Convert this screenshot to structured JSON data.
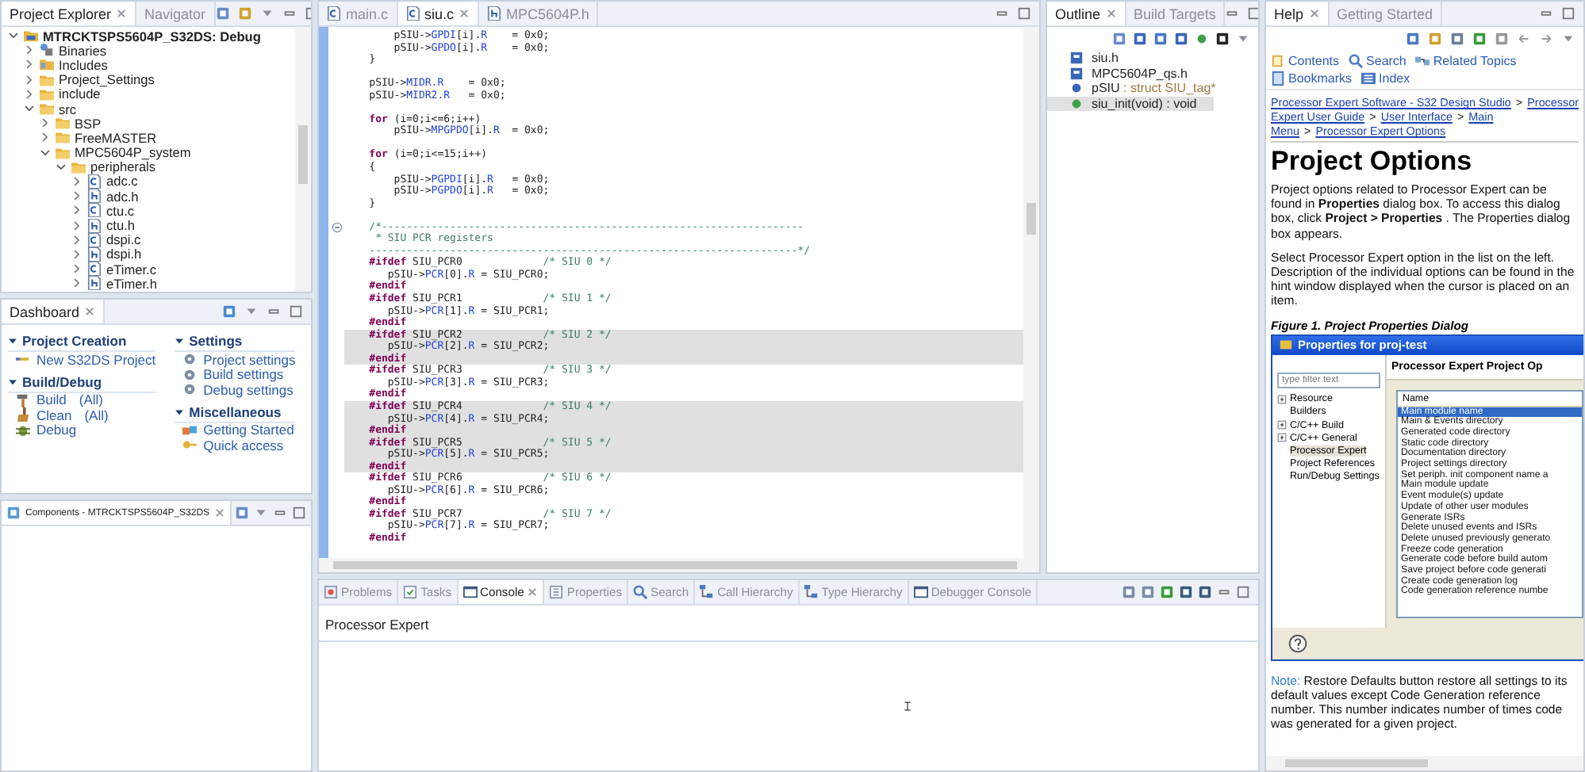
{
  "project_explorer": {
    "tabs": [
      {
        "label": "Project Explorer",
        "selected": true
      },
      {
        "label": "Navigator",
        "selected": false
      }
    ],
    "tree": [
      {
        "label": "MTRCKTSPS5604P_S32DS: Debug",
        "kind": "project",
        "expanded": true,
        "children": [
          {
            "label": "Binaries",
            "kind": "binaries",
            "expanded": false
          },
          {
            "label": "Includes",
            "kind": "includes",
            "expanded": false
          },
          {
            "label": "Project_Settings",
            "kind": "folder",
            "expanded": false
          },
          {
            "label": "include",
            "kind": "folder",
            "expanded": false
          },
          {
            "label": "src",
            "kind": "folder",
            "expanded": true,
            "children": [
              {
                "label": "BSP",
                "kind": "folder",
                "expanded": false
              },
              {
                "label": "FreeMASTER",
                "kind": "folder",
                "expanded": false
              },
              {
                "label": "MPC5604P_system",
                "kind": "folder",
                "expanded": true,
                "children": [
                  {
                    "label": "peripherals",
                    "kind": "folder",
                    "expanded": true,
                    "children": [
                      {
                        "label": "adc.c",
                        "kind": "c",
                        "expanded": false
                      },
                      {
                        "label": "adc.h",
                        "kind": "h",
                        "expanded": false
                      },
                      {
                        "label": "ctu.c",
                        "kind": "c",
                        "expanded": false
                      },
                      {
                        "label": "ctu.h",
                        "kind": "h",
                        "expanded": false
                      },
                      {
                        "label": "dspi.c",
                        "kind": "c",
                        "expanded": false
                      },
                      {
                        "label": "dspi.h",
                        "kind": "h",
                        "expanded": false
                      },
                      {
                        "label": "eTimer.c",
                        "kind": "c",
                        "expanded": false
                      },
                      {
                        "label": "eTimer.h",
                        "kind": "h",
                        "expanded": false
                      }
                    ]
                  }
                ]
              }
            ]
          }
        ]
      }
    ]
  },
  "dashboard": {
    "title": "Dashboard",
    "columns": [
      [
        {
          "title": "Project Creation",
          "expanded": true,
          "links": [
            {
              "label": "New S32DS Project",
              "kind": "new"
            }
          ]
        },
        {
          "title": "Build/Debug",
          "expanded": true,
          "links": [
            {
              "label": "Build",
              "extra": "(All)",
              "kind": "build"
            },
            {
              "label": "Clean",
              "extra": "(All)",
              "kind": "clean"
            },
            {
              "label": "Debug",
              "kind": "debug"
            }
          ]
        }
      ],
      [
        {
          "title": "Settings",
          "expanded": true,
          "links": [
            {
              "label": "Project settings",
              "kind": "settings"
            },
            {
              "label": "Build settings",
              "kind": "settings"
            },
            {
              "label": "Debug settings",
              "kind": "settings"
            }
          ]
        },
        {
          "title": "Miscellaneous",
          "expanded": true,
          "links": [
            {
              "label": "Getting Started",
              "kind": "started"
            },
            {
              "label": "Quick access",
              "kind": "key"
            }
          ]
        }
      ]
    ]
  },
  "components": {
    "title": "Components - MTRCKTSPS5604P_S32DS"
  },
  "editor": {
    "tabs": [
      {
        "label": "main.c",
        "kind": "c",
        "selected": false
      },
      {
        "label": "siu.c",
        "kind": "c",
        "selected": true
      },
      {
        "label": "MPC5604P.h",
        "kind": "h",
        "selected": false
      }
    ],
    "lines": [
      {
        "kind": "code",
        "shaded": false,
        "tokens": [
          {
            "kind": "plain",
            "text": "        pSIU->"
          },
          {
            "kind": "field",
            "text": "GPDI"
          },
          {
            "kind": "plain",
            "text": "[i]."
          },
          {
            "kind": "field",
            "text": "R"
          },
          {
            "kind": "plain",
            "text": "    = 0x0;"
          }
        ]
      },
      {
        "kind": "code",
        "shaded": false,
        "tokens": [
          {
            "kind": "plain",
            "text": "        pSIU->"
          },
          {
            "kind": "field",
            "text": "GPDO"
          },
          {
            "kind": "plain",
            "text": "[i]."
          },
          {
            "kind": "field",
            "text": "R"
          },
          {
            "kind": "plain",
            "text": "    = 0x0;"
          }
        ]
      },
      {
        "kind": "code",
        "shaded": false,
        "tokens": [
          {
            "kind": "plain",
            "text": "    }"
          }
        ]
      },
      {
        "kind": "blank",
        "shaded": false
      },
      {
        "kind": "code",
        "shaded": false,
        "tokens": [
          {
            "kind": "plain",
            "text": "    pSIU->"
          },
          {
            "kind": "field",
            "text": "MIDR.R"
          },
          {
            "kind": "plain",
            "text": "    = 0x0;"
          }
        ]
      },
      {
        "kind": "code",
        "shaded": false,
        "tokens": [
          {
            "kind": "plain",
            "text": "    pSIU->"
          },
          {
            "kind": "field",
            "text": "MIDR2.R"
          },
          {
            "kind": "plain",
            "text": "   = 0x0;"
          }
        ]
      },
      {
        "kind": "blank",
        "shaded": false
      },
      {
        "kind": "code",
        "shaded": false,
        "tokens": [
          {
            "kind": "keyword",
            "text": "    for"
          },
          {
            "kind": "plain",
            "text": " (i=0;i<=6;i++)"
          }
        ]
      },
      {
        "kind": "code",
        "shaded": false,
        "tokens": [
          {
            "kind": "plain",
            "text": "        pSIU->"
          },
          {
            "kind": "field",
            "text": "MPGPDO"
          },
          {
            "kind": "plain",
            "text": "[i]."
          },
          {
            "kind": "field",
            "text": "R"
          },
          {
            "kind": "plain",
            "text": "  = 0x0;"
          }
        ]
      },
      {
        "kind": "blank",
        "shaded": false
      },
      {
        "kind": "code",
        "shaded": false,
        "tokens": [
          {
            "kind": "keyword",
            "text": "    for"
          },
          {
            "kind": "plain",
            "text": " (i=0;i<=15;i++)"
          }
        ]
      },
      {
        "kind": "code",
        "shaded": false,
        "tokens": [
          {
            "kind": "plain",
            "text": "    {"
          }
        ]
      },
      {
        "kind": "code",
        "shaded": false,
        "tokens": [
          {
            "kind": "plain",
            "text": "        pSIU->"
          },
          {
            "kind": "field",
            "text": "PGPDI"
          },
          {
            "kind": "plain",
            "text": "[i]."
          },
          {
            "kind": "field",
            "text": "R"
          },
          {
            "kind": "plain",
            "text": "   = 0x0;"
          }
        ]
      },
      {
        "kind": "code",
        "shaded": false,
        "tokens": [
          {
            "kind": "plain",
            "text": "        pSIU->"
          },
          {
            "kind": "field",
            "text": "PGPDO"
          },
          {
            "kind": "plain",
            "text": "[i]."
          },
          {
            "kind": "field",
            "text": "R"
          },
          {
            "kind": "plain",
            "text": "   = 0x0;"
          }
        ]
      },
      {
        "kind": "code",
        "shaded": false,
        "tokens": [
          {
            "kind": "plain",
            "text": "    }"
          }
        ]
      },
      {
        "kind": "blank",
        "shaded": false
      },
      {
        "kind": "fold",
        "shaded": false,
        "tokens": [
          {
            "kind": "comment",
            "text": "    /*--------------------------------------------------------------------"
          }
        ]
      },
      {
        "kind": "code",
        "shaded": false,
        "tokens": [
          {
            "kind": "comment",
            "text": "     * SIU PCR registers"
          }
        ]
      },
      {
        "kind": "code",
        "shaded": false,
        "tokens": [
          {
            "kind": "comment",
            "text": "    ---------------------------------------------------------------------*/"
          }
        ]
      },
      {
        "kind": "code",
        "shaded": false,
        "tokens": [
          {
            "kind": "keyword",
            "text": "    #ifdef"
          },
          {
            "kind": "plain",
            "text": " SIU_PCR0"
          },
          {
            "kind": "comment",
            "text": "             /* SIU 0 */"
          }
        ]
      },
      {
        "kind": "code",
        "shaded": false,
        "tokens": [
          {
            "kind": "plain",
            "text": "       pSIU->"
          },
          {
            "kind": "field",
            "text": "PCR"
          },
          {
            "kind": "plain",
            "text": "[0]."
          },
          {
            "kind": "field",
            "text": "R"
          },
          {
            "kind": "plain",
            "text": " = SIU_PCR0;"
          }
        ]
      },
      {
        "kind": "code",
        "shaded": false,
        "tokens": [
          {
            "kind": "keyword",
            "text": "    #endif"
          }
        ]
      },
      {
        "kind": "code",
        "shaded": false,
        "tokens": [
          {
            "kind": "keyword",
            "text": "    #ifdef"
          },
          {
            "kind": "plain",
            "text": " SIU_PCR1"
          },
          {
            "kind": "comment",
            "text": "             /* SIU 1 */"
          }
        ]
      },
      {
        "kind": "code",
        "shaded": false,
        "tokens": [
          {
            "kind": "plain",
            "text": "       pSIU->"
          },
          {
            "kind": "field",
            "text": "PCR"
          },
          {
            "kind": "plain",
            "text": "[1]."
          },
          {
            "kind": "field",
            "text": "R"
          },
          {
            "kind": "plain",
            "text": " = SIU_PCR1;"
          }
        ]
      },
      {
        "kind": "code",
        "shaded": false,
        "tokens": [
          {
            "kind": "keyword",
            "text": "    #endif"
          }
        ]
      },
      {
        "kind": "code",
        "shaded": true,
        "tokens": [
          {
            "kind": "keyword",
            "text": "    #ifdef"
          },
          {
            "kind": "plain",
            "text": " SIU_PCR2"
          },
          {
            "kind": "comment",
            "text": "             /* SIU 2 */"
          }
        ]
      },
      {
        "kind": "code",
        "shaded": true,
        "tokens": [
          {
            "kind": "plain",
            "text": "       pSIU->"
          },
          {
            "kind": "field",
            "text": "PCR"
          },
          {
            "kind": "plain",
            "text": "[2]."
          },
          {
            "kind": "field",
            "text": "R"
          },
          {
            "kind": "plain",
            "text": " = SIU_PCR2;"
          }
        ]
      },
      {
        "kind": "code",
        "shaded": true,
        "tokens": [
          {
            "kind": "keyword",
            "text": "    #endif"
          }
        ]
      },
      {
        "kind": "code",
        "shaded": false,
        "tokens": [
          {
            "kind": "keyword",
            "text": "    #ifdef"
          },
          {
            "kind": "plain",
            "text": " SIU_PCR3"
          },
          {
            "kind": "comment",
            "text": "             /* SIU 3 */"
          }
        ]
      },
      {
        "kind": "code",
        "shaded": false,
        "tokens": [
          {
            "kind": "plain",
            "text": "       pSIU->"
          },
          {
            "kind": "field",
            "text": "PCR"
          },
          {
            "kind": "plain",
            "text": "[3]."
          },
          {
            "kind": "field",
            "text": "R"
          },
          {
            "kind": "plain",
            "text": " = SIU_PCR3;"
          }
        ]
      },
      {
        "kind": "code",
        "shaded": false,
        "tokens": [
          {
            "kind": "keyword",
            "text": "    #endif"
          }
        ]
      },
      {
        "kind": "code",
        "shaded": true,
        "tokens": [
          {
            "kind": "keyword",
            "text": "    #ifdef"
          },
          {
            "kind": "plain",
            "text": " SIU_PCR4"
          },
          {
            "kind": "comment",
            "text": "             /* SIU 4 */"
          }
        ]
      },
      {
        "kind": "code",
        "shaded": true,
        "tokens": [
          {
            "kind": "plain",
            "text": "       pSIU->"
          },
          {
            "kind": "field",
            "text": "PCR"
          },
          {
            "kind": "plain",
            "text": "[4]."
          },
          {
            "kind": "field",
            "text": "R"
          },
          {
            "kind": "plain",
            "text": " = SIU_PCR4;"
          }
        ]
      },
      {
        "kind": "code",
        "shaded": true,
        "tokens": [
          {
            "kind": "keyword",
            "text": "    #endif"
          }
        ]
      },
      {
        "kind": "code",
        "shaded": true,
        "tokens": [
          {
            "kind": "keyword",
            "text": "    #ifdef"
          },
          {
            "kind": "plain",
            "text": " SIU_PCR5"
          },
          {
            "kind": "comment",
            "text": "             /* SIU 5 */"
          }
        ]
      },
      {
        "kind": "code",
        "shaded": true,
        "tokens": [
          {
            "kind": "plain",
            "text": "       pSIU->"
          },
          {
            "kind": "field",
            "text": "PCR"
          },
          {
            "kind": "plain",
            "text": "[5]."
          },
          {
            "kind": "field",
            "text": "R"
          },
          {
            "kind": "plain",
            "text": " = SIU_PCR5;"
          }
        ]
      },
      {
        "kind": "code",
        "shaded": true,
        "tokens": [
          {
            "kind": "keyword",
            "text": "    #endif"
          }
        ]
      },
      {
        "kind": "code",
        "shaded": false,
        "tokens": [
          {
            "kind": "keyword",
            "text": "    #ifdef"
          },
          {
            "kind": "plain",
            "text": " SIU_PCR6"
          },
          {
            "kind": "comment",
            "text": "             /* SIU 6 */"
          }
        ]
      },
      {
        "kind": "code",
        "shaded": false,
        "tokens": [
          {
            "kind": "plain",
            "text": "       pSIU->"
          },
          {
            "kind": "field",
            "text": "PCR"
          },
          {
            "kind": "plain",
            "text": "[6]."
          },
          {
            "kind": "field",
            "text": "R"
          },
          {
            "kind": "plain",
            "text": " = SIU_PCR6;"
          }
        ]
      },
      {
        "kind": "code",
        "shaded": false,
        "tokens": [
          {
            "kind": "keyword",
            "text": "    #endif"
          }
        ]
      },
      {
        "kind": "code",
        "shaded": false,
        "tokens": [
          {
            "kind": "keyword",
            "text": "    #ifdef"
          },
          {
            "kind": "plain",
            "text": " SIU_PCR7"
          },
          {
            "kind": "comment",
            "text": "             /* SIU 7 */"
          }
        ]
      },
      {
        "kind": "code",
        "shaded": false,
        "tokens": [
          {
            "kind": "plain",
            "text": "       pSIU->"
          },
          {
            "kind": "field",
            "text": "PCR"
          },
          {
            "kind": "plain",
            "text": "[7]."
          },
          {
            "kind": "field",
            "text": "R"
          },
          {
            "kind": "plain",
            "text": " = SIU_PCR7;"
          }
        ]
      },
      {
        "kind": "code",
        "shaded": false,
        "tokens": [
          {
            "kind": "keyword",
            "text": "    #endif"
          }
        ]
      }
    ]
  },
  "outline": {
    "tabs": [
      {
        "label": "Outline",
        "selected": true
      },
      {
        "label": "Build Targets",
        "selected": false
      }
    ],
    "items": [
      {
        "name": "siu.h",
        "kind": "include",
        "selected": false
      },
      {
        "name": "MPC5604P_qs.h",
        "kind": "include",
        "selected": false
      },
      {
        "name": "pSIU",
        "detail": " : struct SIU_tag*",
        "kind": "variable",
        "selected": false
      },
      {
        "name": "siu_init(void) : void",
        "kind": "function",
        "selected": true
      }
    ]
  },
  "help": {
    "tabs": [
      {
        "label": "Help",
        "selected": true
      },
      {
        "label": "Getting Started",
        "selected": false
      }
    ],
    "nav": [
      {
        "label": "Contents",
        "kind": "contents"
      },
      {
        "label": "Search",
        "kind": "search"
      },
      {
        "label": "Related Topics",
        "kind": "topics"
      },
      {
        "label": "Bookmarks",
        "kind": "bookmarks"
      },
      {
        "label": "Index",
        "kind": "index"
      }
    ],
    "breadcrumb": [
      "Processor Expert Software - S32 Design Studio",
      "Processor Expert User Guide",
      "User Interface",
      "Main Menu",
      "Processor Expert Options"
    ],
    "breadcrumb_separator": ">",
    "title": "Project Options",
    "paragraphs": [
      "Project options related to Processor Expert can be found in **Properties** dialog box. To access this dialog box, click **Project > Properties** . The Properties dialog box appears.",
      "Select Processor Expert option in the list on the left. Description of the individual options can be found in the hint window displayed when the cursor is placed on an item."
    ],
    "figure_caption": "Figure 1. Project Properties Dialog",
    "figure": {
      "title": "Properties for proj-test",
      "filter_placeholder": "type filter text",
      "tree": [
        {
          "label": "Resource",
          "expandable": true,
          "selected": false
        },
        {
          "label": "Builders",
          "expandable": false,
          "selected": false
        },
        {
          "label": "C/C++ Build",
          "expandable": true,
          "selected": false
        },
        {
          "label": "C/C++ General",
          "expandable": true,
          "selected": false
        },
        {
          "label": "Processor Expert",
          "expandable": false,
          "selected": true
        },
        {
          "label": "Project References",
          "expandable": false,
          "selected": false
        },
        {
          "label": "Run/Debug Settings",
          "expandable": false,
          "selected": false
        }
      ],
      "heading": "Processor Expert Project Op",
      "column": "Name",
      "rows": [
        {
          "label": "Main module name",
          "selected": true
        },
        {
          "label": "Main & Events directory",
          "selected": false
        },
        {
          "label": "Generated code directory",
          "selected": false
        },
        {
          "label": "Static code directory",
          "selected": false
        },
        {
          "label": "Documentation directory",
          "selected": false
        },
        {
          "label": "Project settings directory",
          "selected": false
        },
        {
          "label": "Set periph. init component name a",
          "selected": false
        },
        {
          "label": "Main module update",
          "selected": false
        },
        {
          "label": "Event module(s) update",
          "selected": false
        },
        {
          "label": "Update of other user modules",
          "selected": false
        },
        {
          "label": "Generate ISRs",
          "selected": false
        },
        {
          "label": "Delete unused events and ISRs",
          "selected": false
        },
        {
          "label": "Delete unused previously generato",
          "selected": false
        },
        {
          "label": "Freeze code generation",
          "selected": false
        },
        {
          "label": "Generate code before build autom",
          "selected": false
        },
        {
          "label": "Save project before code generati",
          "selected": false
        },
        {
          "label": "Create code generation log",
          "selected": false
        },
        {
          "label": "Code generation reference numbe",
          "selected": false
        }
      ]
    },
    "note": {
      "label": "Note:",
      "text": " Restore Defaults button restore all settings to its default values except Code Generation reference number. This number indicates number of times code was generated for a given project."
    }
  },
  "console": {
    "tabs": [
      {
        "label": "Problems",
        "kind": "problems",
        "selected": false
      },
      {
        "label": "Tasks",
        "kind": "tasks",
        "selected": false
      },
      {
        "label": "Console",
        "kind": "console",
        "selected": true
      },
      {
        "label": "Properties",
        "kind": "properties",
        "selected": false
      },
      {
        "label": "Search",
        "kind": "search",
        "selected": false
      },
      {
        "label": "Call Hierarchy",
        "kind": "hierarchy",
        "selected": false
      },
      {
        "label": "Type Hierarchy",
        "kind": "hierarchy",
        "selected": false
      },
      {
        "label": "Debugger Console",
        "kind": "console",
        "selected": false
      }
    ],
    "title": "Processor Expert"
  }
}
